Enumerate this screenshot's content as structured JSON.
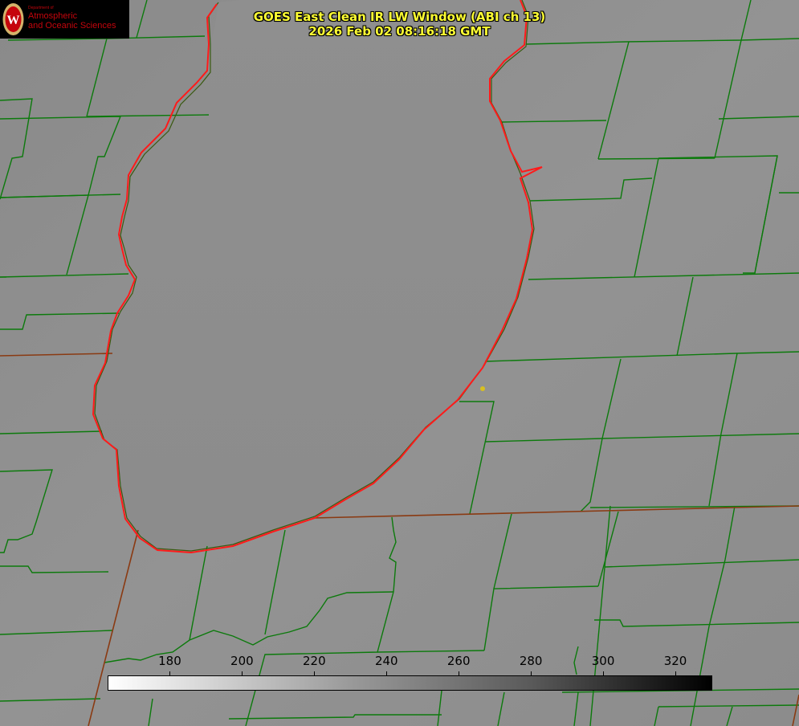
{
  "title_line1": "GOES East Clean IR LW Window (ABI ch 13)",
  "title_line2": "2026 Feb 02 08:16:18 GMT",
  "logo": {
    "department": "Department of",
    "line1": "Atmospheric",
    "line2": "and Oceanic Sciences",
    "seal_letter": "W"
  },
  "colorbar": {
    "ticks": [
      "180",
      "200",
      "220",
      "240",
      "260",
      "280",
      "300",
      "320"
    ],
    "min_value": 163,
    "max_value": 330
  },
  "colors": {
    "county_lines": "#0c7a0c",
    "lake_outline": "#ff1a1a",
    "state_lines": "#8a3a12",
    "title_text": "#ffff33",
    "marker": "#d8c020"
  }
}
